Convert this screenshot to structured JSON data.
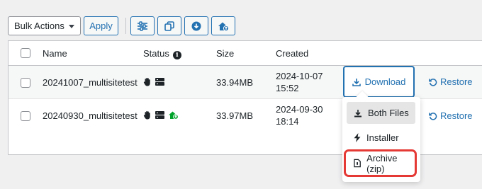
{
  "toolbar": {
    "bulk_actions_label": "Bulk Actions",
    "apply_label": "Apply",
    "icon_buttons": [
      "filter-settings-icon",
      "copy-icon",
      "download-circle-icon",
      "home-upload-icon"
    ]
  },
  "table": {
    "headers": {
      "name": "Name",
      "status": "Status",
      "size": "Size",
      "created": "Created"
    },
    "rows": [
      {
        "name": "20241007_multisitetest",
        "status_icons": [
          "hand-icon",
          "server-icon"
        ],
        "size": "33.94MB",
        "created_date": "2024-10-07",
        "created_time": "15:52",
        "download_label": "Download",
        "restore_label": "Restore"
      },
      {
        "name": "20240930_multisitetest",
        "status_icons": [
          "hand-icon",
          "server-icon",
          "home-upload-green-icon"
        ],
        "size": "33.97MB",
        "created_date": "2024-09-30",
        "created_time": "18:14",
        "restore_label": "Restore"
      }
    ]
  },
  "download_menu": {
    "items": [
      {
        "label": "Both Files",
        "icon": "download-icon",
        "active": true
      },
      {
        "label": "Installer",
        "icon": "bolt-icon",
        "active": false
      },
      {
        "label": "Archive (zip)",
        "icon": "file-zip-icon",
        "active": false,
        "highlighted": true
      }
    ]
  },
  "colors": {
    "accent": "#2271b1",
    "highlight_border": "#e53935",
    "status_green": "#00a32a"
  }
}
